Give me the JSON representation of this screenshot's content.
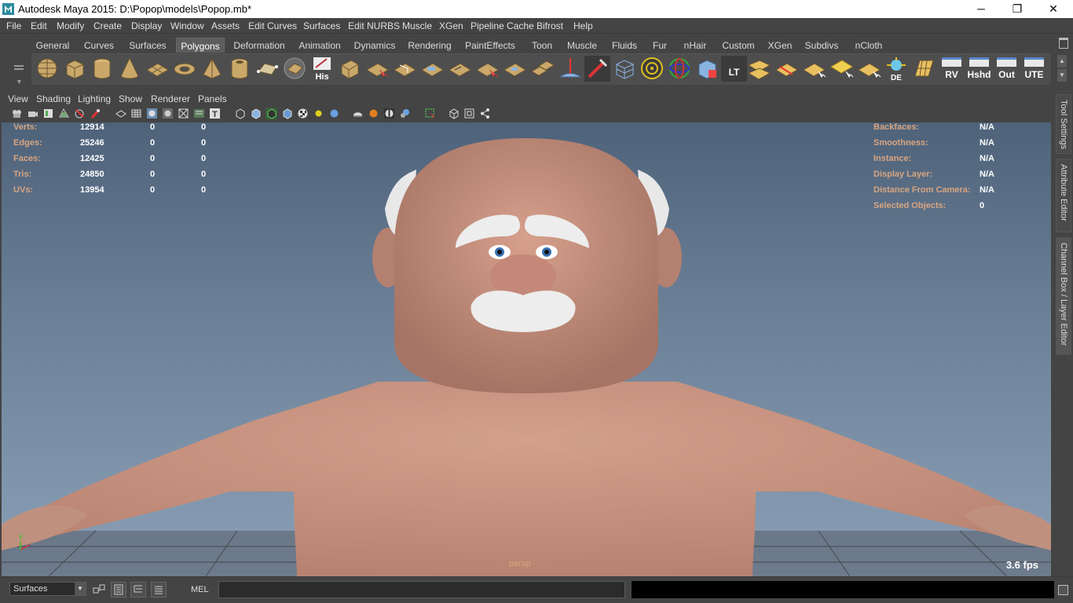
{
  "window": {
    "title": "Autodesk Maya 2015: D:\\Popop\\models\\Popop.mb*",
    "minimize": "─",
    "restore": "❐",
    "close": "✕"
  },
  "menus": [
    "File",
    "Edit",
    "Modify",
    "Create",
    "Display",
    "Window",
    "Assets",
    "Edit Curves",
    "Surfaces",
    "Edit NURBS",
    "Muscle",
    "XGen",
    "Pipeline Cache",
    "Bifrost",
    "Help"
  ],
  "shelf": {
    "tabs": [
      "General",
      "Curves",
      "Surfaces",
      "Polygons",
      "Deformation",
      "Animation",
      "Dynamics",
      "Rendering",
      "PaintEffects",
      "Toon",
      "Muscle",
      "Fluids",
      "Fur",
      "nHair",
      "Custom",
      "XGen",
      "Subdivs",
      "nCloth"
    ],
    "active_tab": "Polygons",
    "text_icons": [
      "His",
      "LT",
      "DE",
      "RV",
      "Hshd",
      "Out",
      "UTE"
    ]
  },
  "panel_menus": [
    "View",
    "Shading",
    "Lighting",
    "Show",
    "Renderer",
    "Panels"
  ],
  "hud_left": [
    {
      "label": "Verts:",
      "v1": "12914",
      "v2": "0",
      "v3": "0"
    },
    {
      "label": "Edges:",
      "v1": "25246",
      "v2": "0",
      "v3": "0"
    },
    {
      "label": "Faces:",
      "v1": "12425",
      "v2": "0",
      "v3": "0"
    },
    {
      "label": "Tris:",
      "v1": "24850",
      "v2": "0",
      "v3": "0"
    },
    {
      "label": "UVs:",
      "v1": "13954",
      "v2": "0",
      "v3": "0"
    }
  ],
  "hud_right": [
    {
      "label": "Backfaces:",
      "value": "N/A"
    },
    {
      "label": "Smoothness:",
      "value": "N/A"
    },
    {
      "label": "Instance:",
      "value": "N/A"
    },
    {
      "label": "Display Layer:",
      "value": "N/A"
    },
    {
      "label": "Distance From Camera:",
      "value": "N/A"
    },
    {
      "label": "Selected Objects:",
      "value": "0"
    }
  ],
  "camera_label": "persp",
  "fps": "3.6 fps",
  "axis": {
    "y": "y",
    "x": "x"
  },
  "dock_tabs": [
    "Tool Settings",
    "Attribute Editor",
    "Channel Box / Layer Editor"
  ],
  "command_line": {
    "selector_value": "Surfaces",
    "mel_label": "MEL"
  },
  "colors": {
    "hud_label": "#d9a580",
    "skin": "#c88f7d",
    "background_top": "#4e627a",
    "background_bottom": "#8ba0b7"
  }
}
